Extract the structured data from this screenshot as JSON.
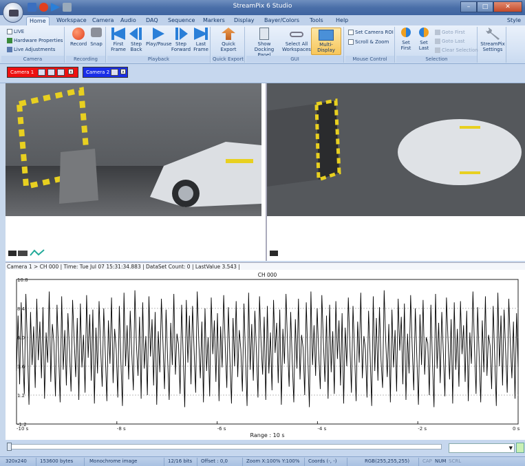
{
  "window": {
    "title": "StreamPix 6 Studio",
    "min": "–",
    "max": "□",
    "close": "✕"
  },
  "menu_tabs": [
    {
      "label": "Home",
      "active": true
    },
    {
      "label": "Workspace"
    },
    {
      "label": "Camera"
    },
    {
      "label": "Audio"
    },
    {
      "label": "DAQ"
    },
    {
      "label": "Sequence"
    },
    {
      "label": "Markers"
    },
    {
      "label": "Display"
    },
    {
      "label": "Bayer/Colors"
    },
    {
      "label": "Tools"
    },
    {
      "label": "Help"
    }
  ],
  "style_label": "Style",
  "ribbon": {
    "camera_group": {
      "label": "Camera",
      "live": "LIVE",
      "hardware_properties": "Hardware Properties",
      "live_adjustments": "Live Adjustments"
    },
    "recording_group": {
      "label": "Recording",
      "record": "Record",
      "snap": "Snap"
    },
    "playback_group": {
      "label": "Playback",
      "first_frame": "First Frame",
      "step_back": "Step Back",
      "play_pause": "Play/Pause",
      "step_forward": "Step Forward",
      "last_frame": "Last Frame"
    },
    "quick_export_group": {
      "label": "Quick Export",
      "quick_export": "Quick Export"
    },
    "gui_group": {
      "label": "GUI",
      "show_docking_panel": "Show Docking Panel",
      "select_all_workspaces": "Select All Workspaces",
      "multi_display": "Multi-Display"
    },
    "mouse_control_group": {
      "label": "Mouse Control",
      "set_camera_roi": "Set Camera ROI",
      "scroll_zoom": "Scroll & Zoom"
    },
    "selection_group": {
      "label": "Selection",
      "set_first": "Set First",
      "set_last": "Set Last",
      "goto_first": "Goto First",
      "goto_last": "Goto Last",
      "clear_selection": "Clear Selection"
    },
    "settings_group": {
      "streampix_settings": "StreamPix Settings"
    }
  },
  "camera_tabs": [
    {
      "label": "Camera 1",
      "color": "#ee1111"
    },
    {
      "label": "Camera 2",
      "color": "#1a2ee8"
    }
  ],
  "info_line": "Camera 1 > CH 000 | Time: Tue Jul 07 15:31:34.883 | DataSet Count: 0 | LastValue 3.543 |",
  "chart_data": {
    "type": "line",
    "title": "CH 000",
    "xlabel": "Range : 10 s",
    "ylabel": "",
    "ylim": [
      -1.2,
      10.8
    ],
    "xlim": [
      -10,
      0
    ],
    "x_ticks": [
      "-10 s",
      "-8 s",
      "-6 s",
      "-4 s",
      "-2 s",
      "0 s"
    ],
    "y_ticks": [
      "10.8",
      "8.4",
      "6.0",
      "3.6",
      "1.2",
      "-1.2"
    ],
    "grid": true,
    "series": [
      {
        "values": [
          3.2,
          7.8,
          2.1,
          8.9,
          4.5,
          1.3,
          9.6,
          5.2,
          0.4,
          8.1,
          3.7,
          6.9,
          1.8,
          9.2,
          4.1,
          7.3,
          2.6,
          8.5,
          0.9,
          6.4,
          3.9,
          9.8,
          2.3,
          7.1,
          5.5,
          1.1,
          8.7,
          4.8,
          0.6,
          9.4,
          3.3,
          6.6,
          2.0,
          8.0,
          4.9,
          1.5,
          9.1,
          5.8,
          2.7,
          7.6,
          0.8,
          8.8,
          3.5,
          6.2,
          1.4,
          9.5,
          4.3,
          7.9,
          2.4,
          8.3,
          0.5,
          6.8,
          3.0,
          9.0,
          5.1,
          1.9,
          8.4,
          4.6,
          0.7,
          7.4,
          3.8,
          9.3,
          2.2,
          6.7,
          5.0,
          1.0,
          8.6,
          4.0,
          0.3,
          9.7,
          3.6,
          7.0,
          2.5,
          8.2,
          4.7,
          1.6,
          9.9,
          5.3,
          2.8,
          7.7,
          0.9,
          8.9,
          3.4,
          6.1,
          1.2,
          9.4,
          4.4,
          7.5,
          2.0,
          8.1,
          0.4,
          6.5,
          3.1,
          9.2,
          5.6,
          1.7,
          8.3,
          4.2,
          0.8,
          7.2,
          3.7,
          9.6,
          2.9,
          6.3,
          5.4,
          1.3,
          8.7,
          4.5,
          0.2,
          9.1,
          3.9,
          7.8,
          2.1,
          8.6,
          4.9,
          1.4,
          9.8,
          5.7,
          2.6,
          7.3,
          0.6,
          8.4,
          3.2,
          6.0,
          1.1,
          9.3,
          4.6,
          7.4,
          2.3,
          8.0,
          0.7,
          6.9,
          3.5,
          9.5,
          5.2,
          1.8,
          8.5,
          4.1,
          0.5,
          7.6,
          3.6,
          9.0,
          2.7,
          6.6,
          5.0,
          1.5,
          8.8,
          4.3,
          0.3,
          9.7,
          3.3,
          7.1,
          2.4,
          8.2,
          4.8,
          1.0,
          9.4,
          5.5,
          2.9,
          7.7,
          0.8,
          8.6,
          3.0,
          6.4,
          1.6,
          9.1,
          4.7,
          7.2,
          2.2,
          8.3,
          0.4,
          6.7,
          3.8,
          9.6,
          5.3,
          1.9,
          8.1,
          4.0,
          0.6,
          7.5,
          3.4,
          9.2,
          2.5,
          6.2,
          5.1,
          1.2,
          8.9,
          4.4,
          0.2,
          9.8,
          3.7,
          7.0,
          2.8,
          8.4,
          4.6,
          1.7,
          9.5,
          5.6,
          2.3,
          7.8,
          0.9,
          8.7,
          3.1,
          6.5,
          1.3,
          9.0,
          4.2,
          7.4,
          2.0,
          8.0,
          0.5,
          6.8,
          3.6,
          9.3,
          5.4,
          1.4,
          8.6,
          4.8,
          0.7,
          7.3,
          3.9,
          9.7,
          2.6,
          6.1,
          5.0,
          1.0,
          8.2,
          4.5,
          0.3,
          9.4,
          3.2,
          7.6,
          2.4,
          8.5,
          4.1,
          1.8,
          9.9,
          5.7,
          2.7,
          7.1,
          0.6,
          8.3,
          3.5,
          6.6,
          1.5,
          9.2,
          4.9,
          7.7,
          2.1,
          8.8,
          0.8,
          6.3,
          3.0,
          9.5,
          5.2,
          1.6,
          8.4,
          4.3,
          0.4,
          7.9,
          3.7,
          9.1,
          2.9,
          6.0,
          5.5,
          1.2,
          8.7,
          4.0,
          0.2,
          9.6,
          3.4,
          7.2,
          2.2,
          8.1,
          4.7,
          1.1,
          9.3,
          5.8,
          2.5,
          7.5,
          0.5,
          8.9,
          3.3,
          6.7,
          1.9,
          9.0,
          4.6,
          7.0,
          2.3,
          8.2,
          0.7,
          6.4,
          3.8,
          9.8,
          5.1,
          1.3,
          8.5,
          4.4,
          0.6,
          7.4,
          3.1,
          9.4,
          2.8,
          6.2,
          5.3,
          1.7,
          8.6,
          4.2,
          0.3,
          9.7,
          3.6,
          7.8,
          2.0,
          8.3,
          4.8,
          1.4,
          9.2,
          5.5,
          2.6,
          7.3,
          0.9,
          8.0,
          3.543
        ]
      }
    ]
  },
  "status_bar": {
    "resolution": "320x240",
    "bytes": "153600 bytes",
    "image_type": "Monochrome image",
    "bits": "12/16 bits",
    "offset": "Offset : 0,0",
    "zoom": "Zoom X:100%  Y:100%",
    "coords": "Coords (-, -)",
    "rgb": "RGB(255,255,255)",
    "cap": "CAP",
    "num": "NUM",
    "scrl": "SCRL"
  },
  "colors": {
    "accent": "#3e64a0",
    "ribbon": "#d7e4f5",
    "record_red": "#e04020",
    "playback_blue": "#2a7fd8"
  }
}
